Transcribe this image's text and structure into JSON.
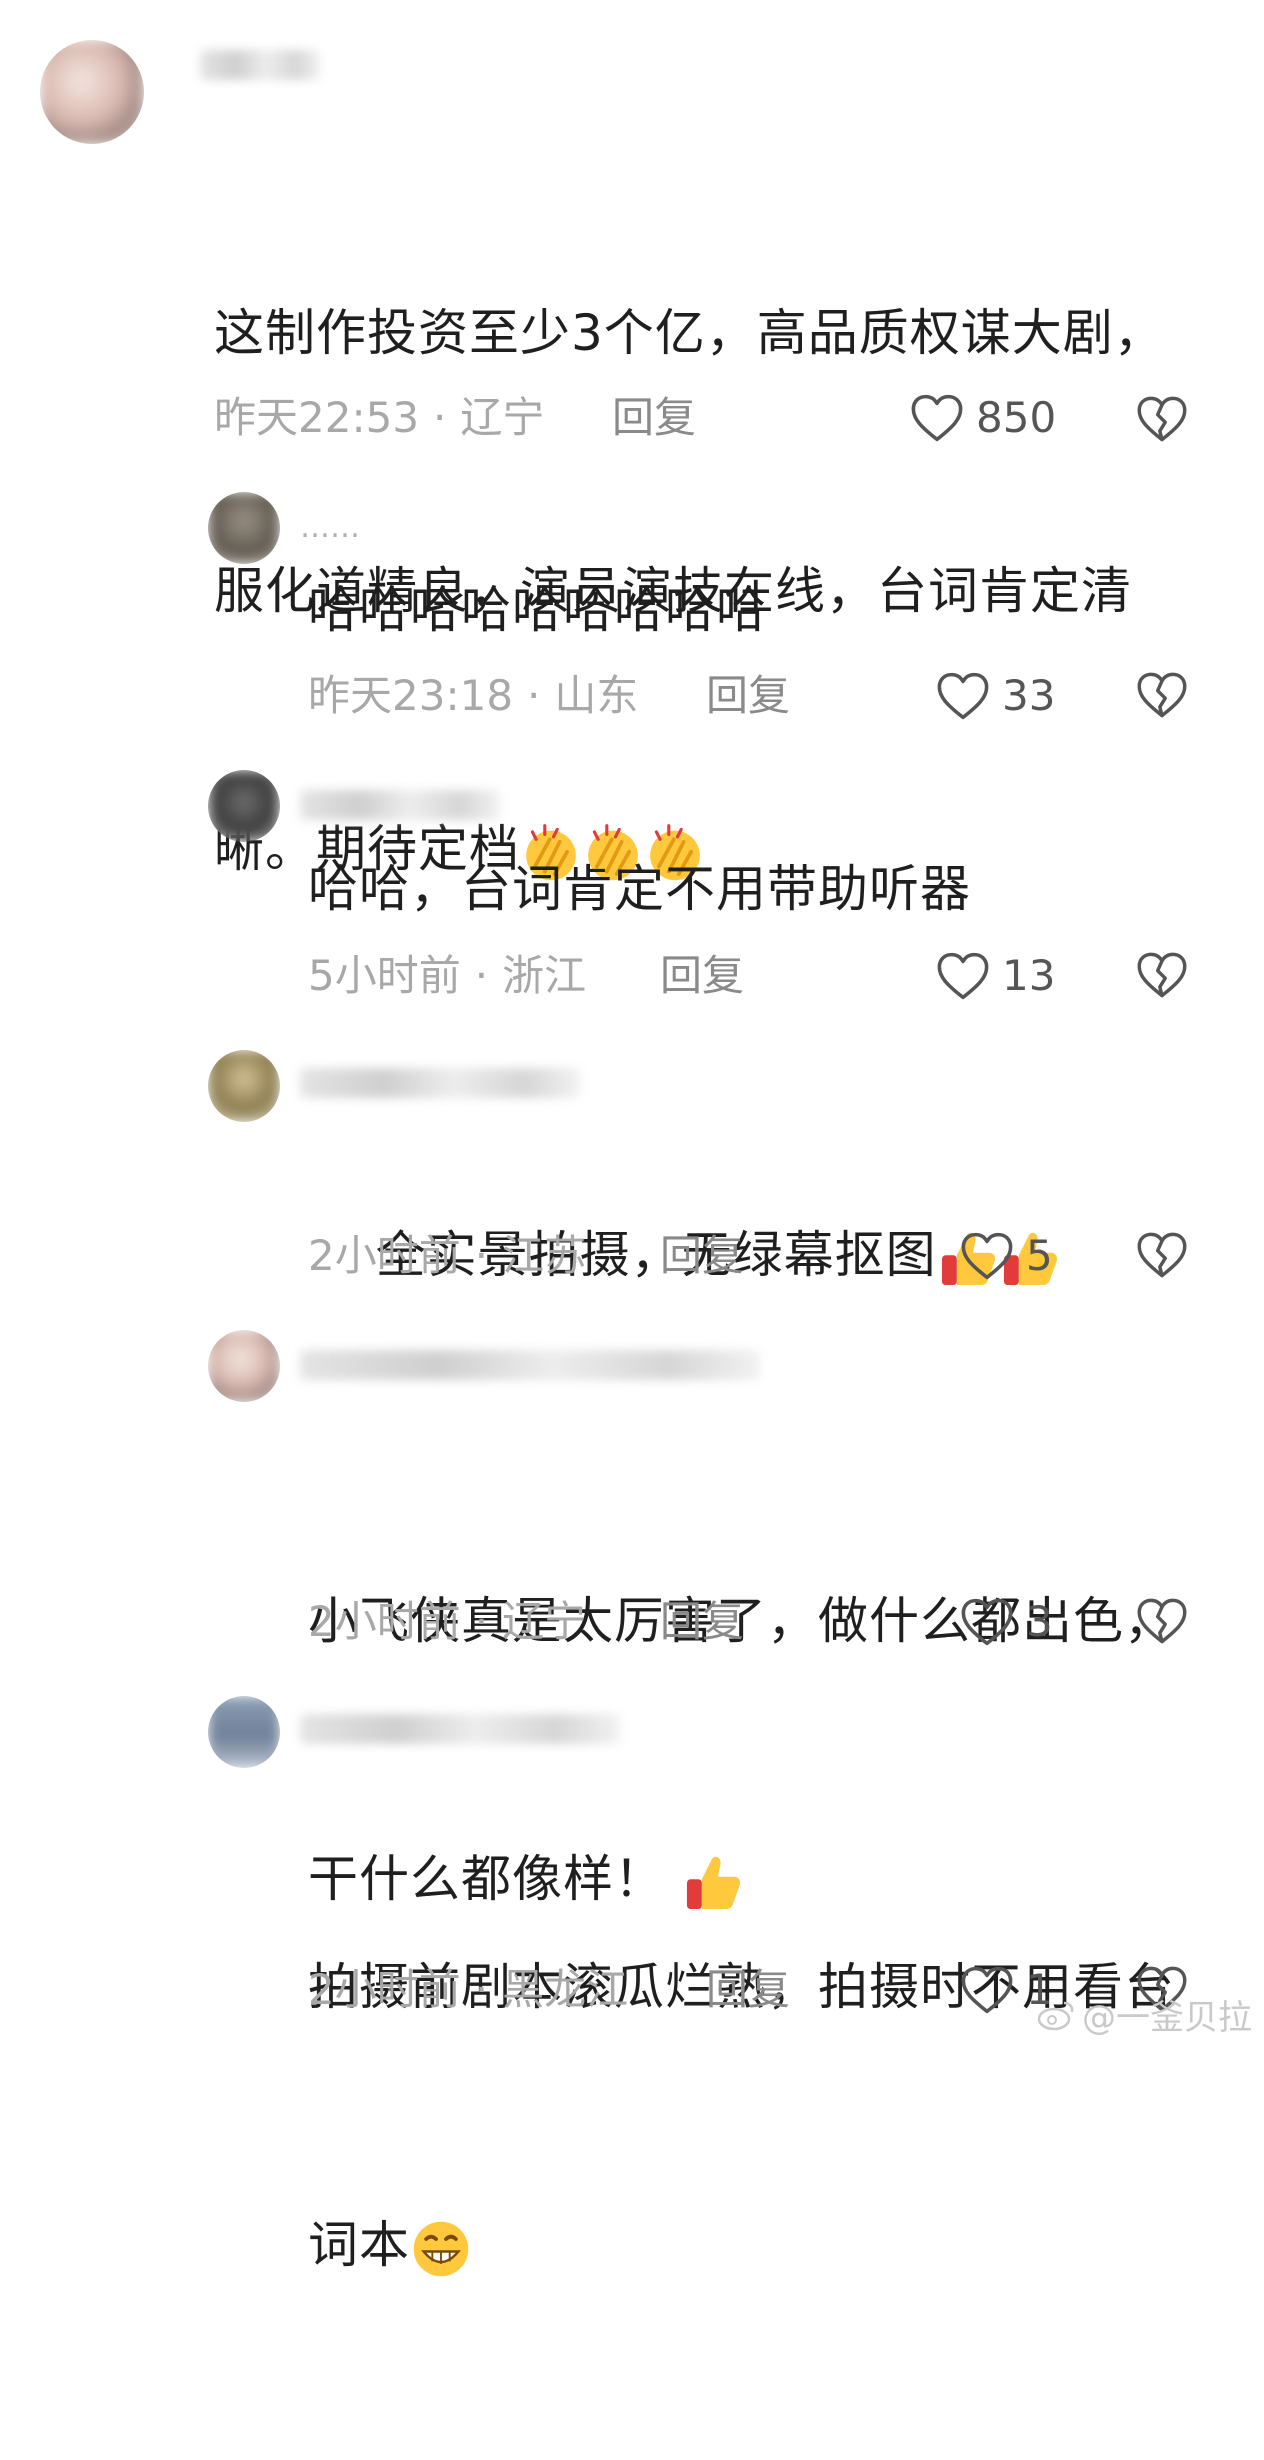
{
  "comments": [
    {
      "text_line1": "这制作投资至少3个亿，高品质权谋大剧，",
      "text_line2": "服化道精良，演员演技在线，台词肯定清",
      "text_line3": "晰。期待定档",
      "time": "昨天22:53",
      "location": "辽宁",
      "reply_label": "回复",
      "likes": "850"
    },
    {
      "username": "……",
      "text_line1": "哈哈哈哈哈哈哈哈哈",
      "time": "昨天23:18",
      "location": "山东",
      "reply_label": "回复",
      "likes": "33"
    },
    {
      "text_line1": "哈哈，台词肯定不用带助听器",
      "time": "5小时前",
      "location": "浙江",
      "reply_label": "回复",
      "likes": "13"
    },
    {
      "text_line1": "全实景拍摄，无绿幕抠图",
      "time": "2小时前",
      "location": "江苏",
      "reply_label": "回复",
      "likes": "5"
    },
    {
      "text_line1": "小飞侠真是太厉害了，做什么都出色，",
      "text_line2": "干什么都像样！",
      "time": "2小时前",
      "location": "辽宁",
      "reply_label": "回复",
      "likes": "3"
    },
    {
      "text_line1": "拍摄前剧本滚瓜烂熟，拍摄时不用看台",
      "text_line2": "词本",
      "time": "2小时前",
      "location": "黑龙江",
      "reply_label": "回复",
      "likes": "1"
    }
  ],
  "meta_separator": "·",
  "watermark": "@一釜贝拉",
  "colors": {
    "text": "#1f1f1f",
    "meta": "#a8a8a8",
    "icon": "#555555"
  }
}
